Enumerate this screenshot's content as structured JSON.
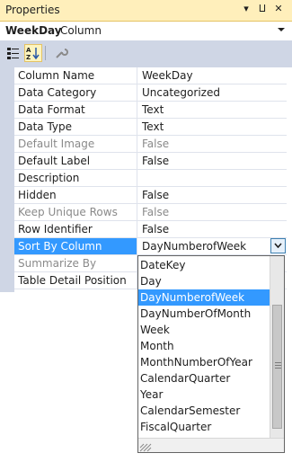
{
  "panel": {
    "title": "Properties",
    "pin": "⨿",
    "close": "✕",
    "menu": "▾"
  },
  "selector": {
    "object_name": "WeekDay",
    "object_type": "Column"
  },
  "properties": [
    {
      "name": "Column Name",
      "value": "WeekDay",
      "state": "normal"
    },
    {
      "name": "Data Category",
      "value": "Uncategorized",
      "state": "normal"
    },
    {
      "name": "Data Format",
      "value": "Text",
      "state": "normal"
    },
    {
      "name": "Data Type",
      "value": "Text",
      "state": "normal"
    },
    {
      "name": "Default Image",
      "value": "False",
      "state": "disabled"
    },
    {
      "name": "Default Label",
      "value": "False",
      "state": "normal"
    },
    {
      "name": "Description",
      "value": "",
      "state": "normal"
    },
    {
      "name": "Hidden",
      "value": "False",
      "state": "normal"
    },
    {
      "name": "Keep Unique Rows",
      "value": "False",
      "state": "disabled"
    },
    {
      "name": "Row Identifier",
      "value": "False",
      "state": "normal"
    },
    {
      "name": "Sort By Column",
      "value": "DayNumberofWeek",
      "state": "selected"
    },
    {
      "name": "Summarize By",
      "value": "",
      "state": "disabled"
    },
    {
      "name": "Table Detail Position",
      "value": "",
      "state": "normal"
    }
  ],
  "dropdown": {
    "highlighted": "DayNumberofWeek",
    "options": [
      "DateKey",
      "Day",
      "DayNumberofWeek",
      "DayNumberOfMonth",
      "Week",
      "Month",
      "MonthNumberOfYear",
      "CalendarQuarter",
      "Year",
      "CalendarSemester",
      "FiscalQuarter"
    ]
  }
}
